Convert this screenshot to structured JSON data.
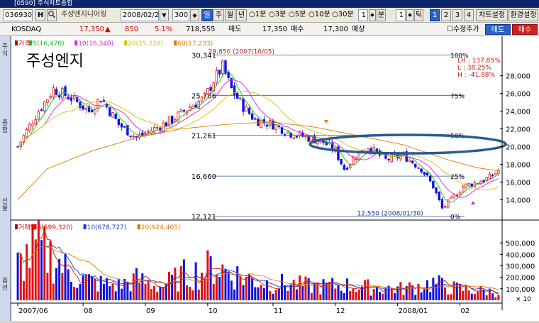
{
  "window": {
    "title": "[0590] 주식차트종합"
  },
  "toolbar": {
    "code": "036930",
    "h_button": "H",
    "search_icon": "magnifier-icon",
    "name": "주성엔지니어링",
    "date": "2008/02/28",
    "count": "300",
    "period_tabs": [
      "일",
      "주",
      "월",
      "년"
    ],
    "minute_options": [
      "1분",
      "3분",
      "5분",
      "10분",
      "30분"
    ],
    "unit_value": "1",
    "unit_label": "분",
    "tick_value": "1",
    "tick_label": "틱",
    "layout_buttons": [
      "1",
      "2",
      "3",
      "4"
    ],
    "chart_settings": "차트설정",
    "env_settings": "환경설정"
  },
  "quote": {
    "market": "KOSDAQ",
    "price": "17,350",
    "change_arrow": "▲",
    "change": "850",
    "change_rate": "5.1%",
    "volume": "718,555",
    "ask_label": "매도",
    "ask": "17,350",
    "bid_label": "매수",
    "bid": "17,300",
    "forecast_label": "예상",
    "adj_label": "수정주가",
    "sell_button": "매도",
    "buy_button": "매수"
  },
  "side_tabs": [
    "주식",
    "종합",
    "선물",
    "옵션"
  ],
  "colors": {
    "up": "#e01010",
    "down": "#1010e0",
    "ma5": "#10c020",
    "ma10": "#e020e0",
    "ma20": "#c8c800",
    "ma60": "#e07800",
    "fib": "#3050a0",
    "ellipse": "#2a5a90"
  },
  "chart_data": [
    {
      "type": "candlestick",
      "annotation_title": "주성엔지",
      "legend": [
        {
          "label": "가격",
          "color": "#c00000"
        },
        {
          "label": "5(16,470)",
          "color": "#10c020"
        },
        {
          "label": "10(16,340)",
          "color": "#e020e0"
        },
        {
          "label": "20(15,228)",
          "color": "#c8c800"
        },
        {
          "label": "60(17,233)",
          "color": "#e07800"
        }
      ],
      "y_ticks": [
        28000,
        26000,
        24000,
        22000,
        20000,
        18000,
        16000,
        14000
      ],
      "y_tick_labels": [
        "28,000",
        "26,000",
        "24,000",
        "22,000",
        "20,000",
        "18,000",
        "16,000",
        "14,000"
      ],
      "ylim": [
        12100,
        30700
      ],
      "x_labels": [
        "2007/06",
        "08",
        "09",
        "10",
        "11",
        "12",
        "2008/01",
        "02"
      ],
      "x_label_index": [
        0,
        22,
        43,
        64,
        86,
        107,
        128,
        149
      ],
      "n_bars": 163,
      "high_point": {
        "value": 30341,
        "label": "30,341",
        "annotation": "29,850 (2007/10/05)",
        "index": 69
      },
      "low_point": {
        "value": 12121,
        "label": "12,121",
        "annotation": "12,550 (2008/01/30)",
        "index": 143
      },
      "fib_levels": [
        {
          "pct": "100%",
          "value": 30341,
          "label": "30,341"
        },
        {
          "pct": "75%",
          "value": 25786,
          "label": "25,786"
        },
        {
          "pct": "50%",
          "value": 21261,
          "label": "21,261"
        },
        {
          "pct": "25%",
          "value": 16660,
          "label": "16,660"
        },
        {
          "pct": "0%",
          "value": 12121,
          "label": "12,121"
        }
      ],
      "stats": [
        "LH : 137.85%",
        "L  :  38.25%",
        "H  : -41.88%"
      ],
      "close_keypoints": [
        [
          0,
          20000
        ],
        [
          6,
          23500
        ],
        [
          12,
          26500
        ],
        [
          18,
          25500
        ],
        [
          24,
          24000
        ],
        [
          28,
          25500
        ],
        [
          34,
          22500
        ],
        [
          40,
          21000
        ],
        [
          46,
          22000
        ],
        [
          52,
          23000
        ],
        [
          58,
          24500
        ],
        [
          63,
          25500
        ],
        [
          66,
          27500
        ],
        [
          69,
          29000
        ],
        [
          72,
          26500
        ],
        [
          76,
          24500
        ],
        [
          80,
          23000
        ],
        [
          86,
          22500
        ],
        [
          92,
          21500
        ],
        [
          98,
          21000
        ],
        [
          103,
          20500
        ],
        [
          107,
          19500
        ],
        [
          110,
          17500
        ],
        [
          114,
          19000
        ],
        [
          118,
          20000
        ],
        [
          124,
          18500
        ],
        [
          130,
          19000
        ],
        [
          136,
          17500
        ],
        [
          140,
          15500
        ],
        [
          143,
          13000
        ],
        [
          146,
          14000
        ],
        [
          150,
          15500
        ],
        [
          155,
          16000
        ],
        [
          159,
          16500
        ],
        [
          162,
          17350
        ]
      ],
      "ma60_keypoints": [
        [
          0,
          14000
        ],
        [
          10,
          17500
        ],
        [
          25,
          19500
        ],
        [
          40,
          21000
        ],
        [
          55,
          22000
        ],
        [
          70,
          22500
        ],
        [
          85,
          22800
        ],
        [
          100,
          22200
        ],
        [
          115,
          21200
        ],
        [
          130,
          20200
        ],
        [
          145,
          18500
        ],
        [
          155,
          17600
        ],
        [
          162,
          17233
        ]
      ]
    },
    {
      "type": "bar",
      "legend": [
        {
          "label": "거래량",
          "color": "#c00000"
        },
        {
          "label": "5(599,320)",
          "color": "#e01010"
        },
        {
          "label": "10(678,727)",
          "color": "#1040d0"
        },
        {
          "label": "20(924,405)",
          "color": "#e07800"
        }
      ],
      "y_ticks": [
        500000,
        400000,
        300000,
        200000,
        100000
      ],
      "y_tick_labels": [
        "500,000",
        "400,000",
        "300,000",
        "200,000",
        "100,000"
      ],
      "ylim": [
        0,
        600000
      ],
      "unit": "× 10",
      "volume_keypoints": [
        [
          0,
          300000
        ],
        [
          6,
          450000
        ],
        [
          12,
          380000
        ],
        [
          18,
          220000
        ],
        [
          26,
          150000
        ],
        [
          34,
          130000
        ],
        [
          40,
          180000
        ],
        [
          48,
          120000
        ],
        [
          56,
          220000
        ],
        [
          62,
          250000
        ],
        [
          66,
          300000
        ],
        [
          70,
          260000
        ],
        [
          76,
          200000
        ],
        [
          84,
          150000
        ],
        [
          92,
          140000
        ],
        [
          100,
          120000
        ],
        [
          110,
          130000
        ],
        [
          120,
          110000
        ],
        [
          130,
          100000
        ],
        [
          140,
          150000
        ],
        [
          146,
          110000
        ],
        [
          152,
          90000
        ],
        [
          158,
          80000
        ],
        [
          162,
          70000
        ]
      ]
    }
  ]
}
